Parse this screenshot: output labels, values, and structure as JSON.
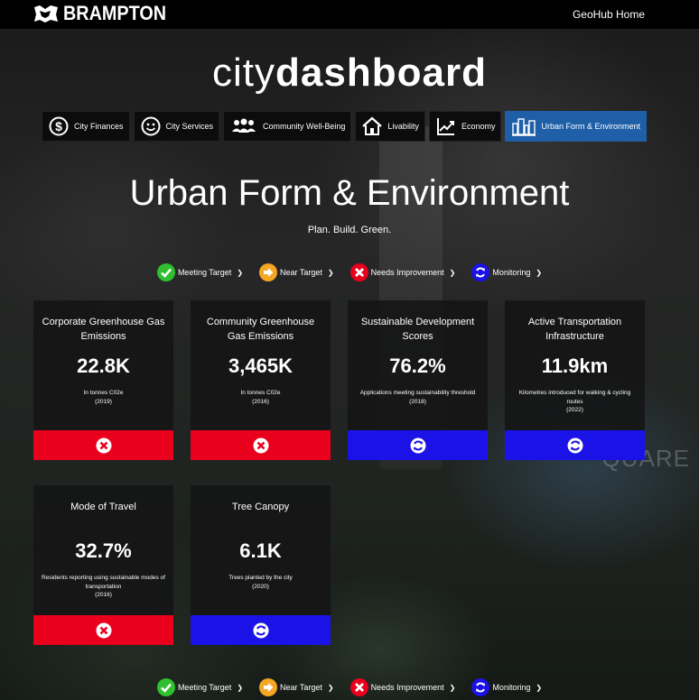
{
  "header": {
    "logo_text": "BRAMPTON",
    "link_label": "GeoHub Home"
  },
  "brand": {
    "prefix": "city",
    "bold": "dashboard"
  },
  "nav": [
    {
      "label": "City Finances",
      "icon": "dollar-icon"
    },
    {
      "label": "City Services",
      "icon": "smile-icon"
    },
    {
      "label": "Community Well-Being",
      "icon": "people-icon"
    },
    {
      "label": "Livability",
      "icon": "home-icon"
    },
    {
      "label": "Economy",
      "icon": "chart-line-icon"
    },
    {
      "label": "Urban Form & Environment",
      "icon": "buildings-icon",
      "active": true
    }
  ],
  "page": {
    "title": "Urban Form & Environment",
    "tagline": "Plan. Build. Green."
  },
  "legend": [
    {
      "label": "Meeting Target",
      "icon": "check-icon",
      "color": "#2fbf2f"
    },
    {
      "label": "Near Target",
      "icon": "arrow-right-icon",
      "color": "#f5a623"
    },
    {
      "label": "Needs Improvement",
      "icon": "x-icon",
      "color": "#e8001c"
    },
    {
      "label": "Monitoring",
      "icon": "sync-icon",
      "color": "#1a12e6"
    }
  ],
  "cards": [
    {
      "title": "Corporate Greenhouse Gas Emissions",
      "value": "22.8K",
      "desc": "In tonnes C02e",
      "year": "(2019)",
      "status": "needs-improvement"
    },
    {
      "title": "Community Greenhouse Gas Emissions",
      "value": "3,465K",
      "desc": "In tonnes C02e",
      "year": "(2016)",
      "status": "needs-improvement"
    },
    {
      "title": "Sustainable Development Scores",
      "value": "76.2%",
      "desc": "Applications meeting sustainability threshold",
      "year": "(2018)",
      "status": "monitoring"
    },
    {
      "title": "Active Transportation Infrastructure",
      "value": "11.9km",
      "desc": "Kilometres introduced for walking & cycling routes",
      "year": "(2022)",
      "status": "monitoring"
    },
    {
      "title": "Mode of Travel",
      "value": "32.7%",
      "desc": "Residents reporting using sustainable modes of transportation",
      "year": "(2016)",
      "status": "needs-improvement"
    },
    {
      "title": "Tree Canopy",
      "value": "6.1K",
      "desc": "Trees planted by the city",
      "year": "(2020)",
      "status": "monitoring"
    }
  ],
  "background_text": "QUARE",
  "colors": {
    "needs_improvement": "#e8001c",
    "monitoring": "#1a12e6",
    "nav_active": "#1e5fa8"
  }
}
